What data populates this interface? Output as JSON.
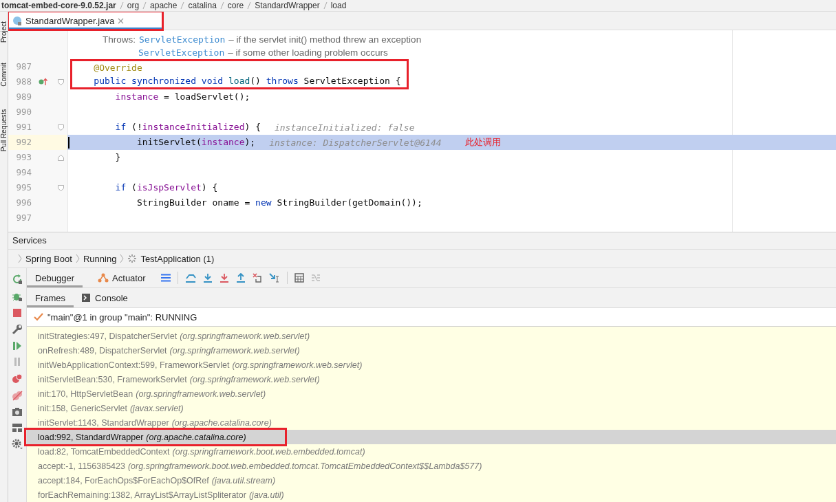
{
  "breadcrumb": [
    "tomcat-embed-core-9.0.52.jar",
    "org",
    "apache",
    "catalina",
    "core",
    "StandardWrapper",
    "load"
  ],
  "side_tools": [
    "Project",
    "Commit",
    "Pull Requests"
  ],
  "editor_tabs": [
    {
      "label": "StandardWrapper.java",
      "selected": true,
      "boxed": true
    }
  ],
  "doc": [
    {
      "prefix": "Throws:",
      "link": "ServletException",
      "text": "– if the servlet init() method threw an exception"
    },
    {
      "link": "ServletException",
      "text": "– if some other loading problem occurs"
    }
  ],
  "code_lines": [
    {
      "number": "987",
      "boxed": true,
      "current": false,
      "fold_open": false,
      "fold_close": false,
      "marker": false,
      "tokens": [
        {
          "text": "    @Override",
          "kind": "annotation"
        }
      ]
    },
    {
      "number": "988",
      "boxed": true,
      "current": false,
      "fold_open": true,
      "fold_close": false,
      "marker": true,
      "tokens": [
        {
          "text": "    public synchronized void ",
          "kind": "keyword"
        },
        {
          "text": "load",
          "kind": "method"
        },
        {
          "text": "() ",
          "kind": "plain"
        },
        {
          "text": "throws",
          "kind": "keyword"
        },
        {
          "text": " ServletException {",
          "kind": "plain"
        }
      ]
    },
    {
      "number": "989",
      "boxed": false,
      "current": false,
      "fold_open": false,
      "fold_close": false,
      "marker": false,
      "tokens": [
        {
          "text": "        instance",
          "kind": "field"
        },
        {
          "text": " = loadServlet();",
          "kind": "plain"
        }
      ]
    },
    {
      "number": "990",
      "boxed": false,
      "current": false,
      "fold_open": false,
      "fold_close": false,
      "marker": false
    },
    {
      "number": "991",
      "boxed": false,
      "current": false,
      "fold_open": true,
      "fold_close": false,
      "marker": false,
      "tokens": [
        {
          "text": "        if",
          "kind": "keyword"
        },
        {
          "text": " (!",
          "kind": "plain"
        },
        {
          "text": "instanceInitialized",
          "kind": "field"
        },
        {
          "text": ") {",
          "kind": "plain"
        }
      ],
      "hint": "instanceInitialized: false"
    },
    {
      "number": "992",
      "boxed": false,
      "current": true,
      "fold_open": false,
      "fold_close": false,
      "marker": false,
      "tokens": [
        {
          "text": "            initServlet(",
          "kind": "plain"
        },
        {
          "text": "instance",
          "kind": "field"
        },
        {
          "text": ");",
          "kind": "plain"
        }
      ],
      "hint": "instance: DispatcherServlet@6144",
      "note": "此处调用"
    },
    {
      "number": "993",
      "boxed": false,
      "current": false,
      "fold_open": false,
      "fold_close": true,
      "marker": false,
      "tokens": [
        {
          "text": "        }",
          "kind": "plain"
        }
      ]
    },
    {
      "number": "994",
      "boxed": false,
      "current": false,
      "fold_open": false,
      "fold_close": false,
      "marker": false
    },
    {
      "number": "995",
      "boxed": false,
      "current": false,
      "fold_open": true,
      "fold_close": false,
      "marker": false,
      "tokens": [
        {
          "text": "        if",
          "kind": "keyword"
        },
        {
          "text": " (",
          "kind": "plain"
        },
        {
          "text": "isJspServlet",
          "kind": "field"
        },
        {
          "text": ") {",
          "kind": "plain"
        }
      ]
    },
    {
      "number": "996",
      "boxed": false,
      "current": false,
      "fold_open": false,
      "fold_close": false,
      "marker": false,
      "tokens": [
        {
          "text": "            StringBuilder oname = ",
          "kind": "plain"
        },
        {
          "text": "new",
          "kind": "keyword"
        },
        {
          "text": " StringBuilder(getDomain());",
          "kind": "plain"
        }
      ]
    },
    {
      "number": "997",
      "boxed": false,
      "current": false,
      "fold_open": false,
      "fold_close": false,
      "marker": false
    }
  ],
  "services": {
    "title": "Services",
    "path": [
      "Spring Boot",
      "Running",
      "TestApplication (1)"
    ]
  },
  "debugger_tabs": [
    {
      "label": "Debugger",
      "selected": true
    },
    {
      "label": "Actuator",
      "selected": false
    }
  ],
  "view_tabs": [
    {
      "label": "Frames",
      "selected": true
    },
    {
      "label": "Console",
      "selected": false
    }
  ],
  "thread": "\"main\"@1 in group \"main\": RUNNING",
  "frames": [
    {
      "location": "initStrategies:497, DispatcherServlet",
      "package": "(org.springframework.web.servlet)",
      "selected": false,
      "boxed": false
    },
    {
      "location": "onRefresh:489, DispatcherServlet",
      "package": "(org.springframework.web.servlet)",
      "selected": false,
      "boxed": false
    },
    {
      "location": "initWebApplicationContext:599, FrameworkServlet",
      "package": "(org.springframework.web.servlet)",
      "selected": false,
      "boxed": false
    },
    {
      "location": "initServletBean:530, FrameworkServlet",
      "package": "(org.springframework.web.servlet)",
      "selected": false,
      "boxed": false
    },
    {
      "location": "init:170, HttpServletBean",
      "package": "(org.springframework.web.servlet)",
      "selected": false,
      "boxed": false
    },
    {
      "location": "init:158, GenericServlet",
      "package": "(javax.servlet)",
      "selected": false,
      "boxed": false
    },
    {
      "location": "initServlet:1143, StandardWrapper",
      "package": "(org.apache.catalina.core)",
      "selected": false,
      "boxed": false
    },
    {
      "location": "load:992, StandardWrapper",
      "package": "(org.apache.catalina.core)",
      "selected": true,
      "boxed": true
    },
    {
      "location": "load:82, TomcatEmbeddedContext",
      "package": "(org.springframework.boot.web.embedded.tomcat)",
      "selected": false,
      "boxed": false
    },
    {
      "location": "accept:-1, 1156385423",
      "package": "(org.springframework.boot.web.embedded.tomcat.TomcatEmbeddedContext$$Lambda$577)",
      "selected": false,
      "boxed": false
    },
    {
      "location": "accept:184, ForEachOps$ForEachOp$OfRef",
      "package": "(java.util.stream)",
      "selected": false,
      "boxed": false
    },
    {
      "location": "forEachRemaining:1382, ArrayList$ArrayListSpliterator",
      "package": "(java.util)",
      "selected": false,
      "boxed": false
    }
  ]
}
